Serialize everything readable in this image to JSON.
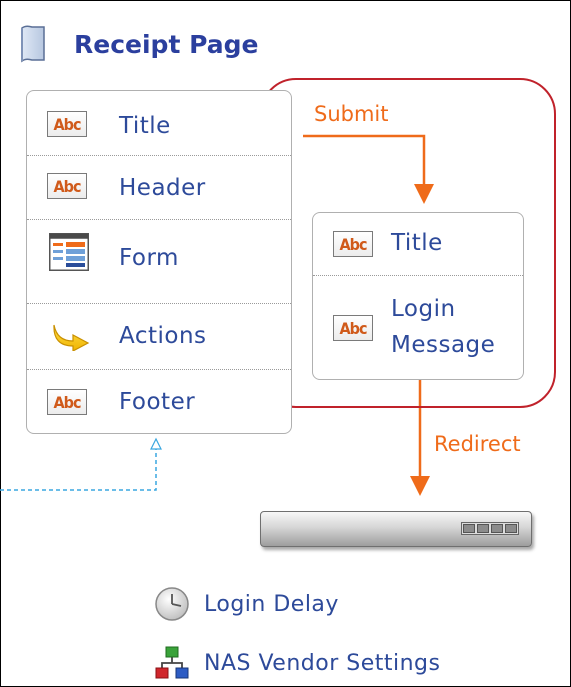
{
  "page": {
    "title": "Receipt Page"
  },
  "left_panel": {
    "items": [
      {
        "label": "Title",
        "icon": "abc-text-icon"
      },
      {
        "label": "Header",
        "icon": "abc-text-icon"
      },
      {
        "label": "Form",
        "icon": "form-icon"
      },
      {
        "label": "Actions",
        "icon": "arrow-actions-icon"
      },
      {
        "label": "Footer",
        "icon": "abc-text-icon"
      }
    ]
  },
  "right_panel": {
    "items": [
      {
        "label": "Title",
        "icon": "abc-text-icon"
      },
      {
        "label_line1": "Login",
        "label_line2": "Message",
        "icon": "abc-text-icon"
      }
    ]
  },
  "flow": {
    "submit_label": "Submit",
    "redirect_label": "Redirect"
  },
  "bottom_list": {
    "items": [
      {
        "label": "Login Delay",
        "icon": "clock-icon"
      },
      {
        "label": "NAS Vendor Settings",
        "icon": "network-icon"
      }
    ]
  },
  "colors": {
    "title_text": "#2b3f9e",
    "item_text": "#2d4a9a",
    "flow_orange": "#ef6b1a",
    "group_outline_red": "#c0222b",
    "dashed_link_blue": "#3aa7e0"
  }
}
